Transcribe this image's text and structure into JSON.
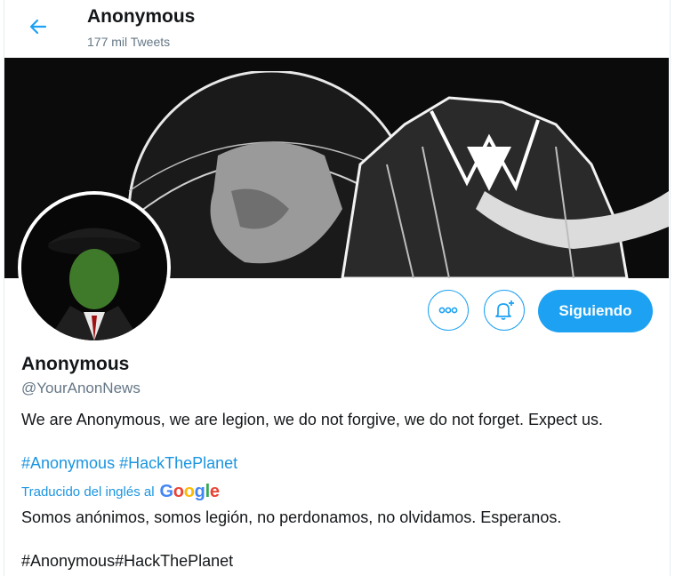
{
  "header": {
    "name": "Anonymous",
    "tweet_count": "177 mil Tweets"
  },
  "profile": {
    "name": "Anonymous",
    "handle": "@YourAnonNews",
    "bio": "We are Anonymous, we are legion, we do not forgive, we do not forget. Expect us.",
    "hashtags": [
      "#Anonymous",
      "#HackThePlanet"
    ],
    "translated_label": "Traducido del inglés al",
    "google_letters": [
      "G",
      "o",
      "o",
      "g",
      "l",
      "e"
    ],
    "translation": "Somos anónimos, somos legión, no perdonamos, no olvidamos. Esperanos.",
    "translated_hashtags": "#Anonymous#HackThePlanet"
  },
  "actions": {
    "follow_label": "Siguiendo"
  },
  "icons": {
    "back": "arrow-left-icon",
    "more": "more-dots-icon",
    "notify": "bell-plus-icon"
  },
  "colors": {
    "accent": "#1da1f2",
    "link": "#1b95e0",
    "google": [
      "#4285f4",
      "#ea4335",
      "#fbbc05",
      "#4285f4",
      "#34a853",
      "#ea4335"
    ]
  }
}
